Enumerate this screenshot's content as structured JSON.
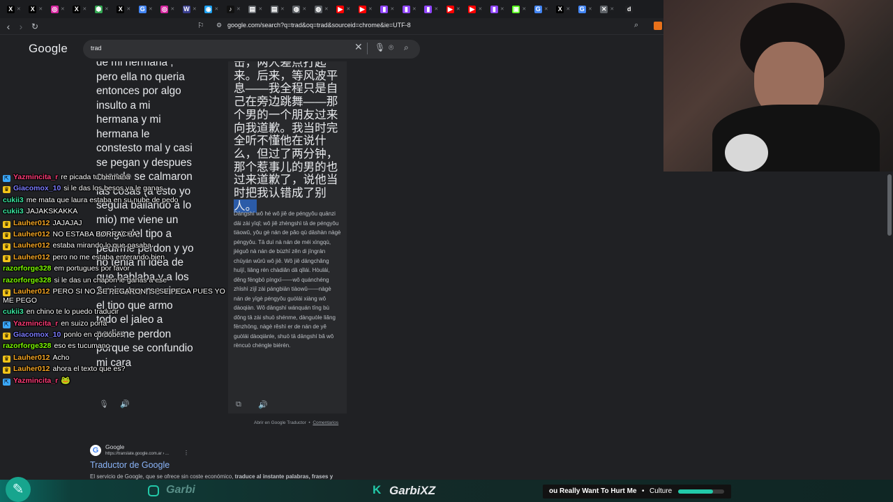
{
  "tabs": [
    {
      "icon": "x-icon",
      "glyph": "X",
      "color": "#000000"
    },
    {
      "icon": "x-icon",
      "glyph": "X",
      "color": "#000000"
    },
    {
      "icon": "instagram-icon",
      "glyph": "◎",
      "color": "#d6249f"
    },
    {
      "icon": "x-icon",
      "glyph": "X",
      "color": "#000000"
    },
    {
      "icon": "chrome-extension-icon",
      "glyph": "⬢",
      "color": "#34a853"
    },
    {
      "icon": "x-icon",
      "glyph": "X",
      "color": "#000000"
    },
    {
      "icon": "google-icon",
      "glyph": "G",
      "color": "#4285f4"
    },
    {
      "icon": "instagram-icon",
      "glyph": "◎",
      "color": "#d6249f"
    },
    {
      "icon": "app-icon",
      "glyph": "W",
      "color": "#3a3f8f"
    },
    {
      "icon": "web-icon",
      "glyph": "◉",
      "color": "#1da1f2"
    },
    {
      "icon": "tiktok-icon",
      "glyph": "♪",
      "color": "#111111"
    },
    {
      "icon": "document-icon",
      "glyph": "▤",
      "color": "#5f6368"
    },
    {
      "icon": "document-icon",
      "glyph": "▤",
      "color": "#5f6368"
    },
    {
      "icon": "globe-icon",
      "glyph": "◍",
      "color": "#5f6368"
    },
    {
      "icon": "globe-icon",
      "glyph": "◍",
      "color": "#5f6368"
    },
    {
      "icon": "youtube-icon",
      "glyph": "▶",
      "color": "#ff0000"
    },
    {
      "icon": "youtube-icon",
      "glyph": "▶",
      "color": "#ff0000"
    },
    {
      "icon": "twitch-icon",
      "glyph": "▮",
      "color": "#9146ff"
    },
    {
      "icon": "twitch-icon",
      "glyph": "▮",
      "color": "#9146ff"
    },
    {
      "icon": "twitch-icon",
      "glyph": "▮",
      "color": "#9146ff"
    },
    {
      "icon": "youtube-icon",
      "glyph": "▶",
      "color": "#ff0000"
    },
    {
      "icon": "youtube-icon",
      "glyph": "▶",
      "color": "#ff0000"
    },
    {
      "icon": "twitch-icon",
      "glyph": "▮",
      "color": "#9146ff"
    },
    {
      "icon": "kick-icon",
      "glyph": "▣",
      "color": "#53fc18"
    },
    {
      "icon": "google-icon",
      "glyph": "G",
      "color": "#4285f4"
    },
    {
      "icon": "x-icon",
      "glyph": "X",
      "color": "#000000"
    },
    {
      "icon": "google-icon",
      "glyph": "G",
      "color": "#4285f4"
    },
    {
      "icon": "mute-icon",
      "glyph": "✕",
      "color": "#5f6368"
    },
    {
      "icon": "d-icon",
      "glyph": "d",
      "color": "#202124"
    }
  ],
  "tab_extra": {
    "last_label": "S"
  },
  "address": {
    "url": "google.com/search?q=trad&oq=trad&sourceid=chrome&ie=UTF-8"
  },
  "google": {
    "logo": "Google",
    "query": "trad"
  },
  "translate": {
    "source_lines": [
      "de mi hermana ,",
      "pero ella no queria",
      "entonces por algo",
      "insulto a mi",
      "hermana y mi",
      "hermana le",
      "constesto mal y casi",
      "se pegan y despues",
      "cuando se calmaron",
      "las cosas (a esto yo",
      "seguia bailando a lo",
      "mio) me viene un",
      "amigo del tipo a",
      "pedirme perdon y yo",
      "no tenia ni idea de",
      "que hablaba y a los",
      "2 minutos me vino",
      "el tipo que armo",
      "todo el jaleo a",
      "pedirme perdon",
      "porque se confundio",
      "mi cara"
    ],
    "target_zh": "击，两人差点打起来。后来，等风波平息——我全程只是自己在旁边跳舞——那个男的一个朋友过来向我道歉。我当时完全听不懂他在说什么，但过了两分钟，那个惹事儿的男的也过来道歉了，说他当时把我认错成了别",
    "target_zh_highlight": "人。",
    "pinyin": "Dāngshí wǒ hé wǒ jiě de péngyǒu quānzi dāi zài yīqǐ; wǒ jiě zhèngshì tā de péngyǒu tiàowǔ, yǒu gè nán de pǎo qù dāshàn nàgè péngyǒu. Tā duì nà nán de méi xìngqù, jiéguǒ nà nán de bùzhī zěn di jīngrán chūyán wǔrǔ wǒ jiě. Wǒ jiě dāngchǎng huíjī, liǎng rén chàdiǎn dǎ qǐlái. Hòulái, děng fēngbō píngxī——wǒ quánchéng zhǐshì zìjǐ zài pángbiān tiàowǔ——nàgè nán de yīgè péngyǒu guòlái xiàng wǒ dàoqiàn. Wǒ dāngshí wánquán tīng bù dǒng tā zài shuō shénme, dànguòle liǎng fēnzhōng, nàgè rěshì er de nán de yě guòlái dàoqiànle, shuō tā dāngshí bǎ wǒ rèncuò chéngle biérén.",
    "open_link": "Abrir en Google Traductor",
    "separator": "•",
    "feedback_link": "Comentarios"
  },
  "chat": [
    {
      "user": "Yazmincita_r",
      "color": "#ff3c78",
      "badge": "#3ba9ff",
      "badge_glyph": "⇱",
      "text": "re picada tu hermana"
    },
    {
      "user": "Giacomox_10",
      "color": "#7b7bff",
      "badge": "#f5c518",
      "badge_glyph": "♛",
      "text": "si le das los besos ya le ganas"
    },
    {
      "user": "cukii3",
      "color": "#39e6a0",
      "badge": "",
      "badge_glyph": "",
      "text": "me mata que laura estaba en su nube de pedo"
    },
    {
      "user": "cukii3",
      "color": "#39e6a0",
      "badge": "",
      "badge_glyph": "",
      "text": "JAJAKSKAKKA"
    },
    {
      "user": "Lauher012",
      "color": "#f5a623",
      "badge": "#f5c518",
      "badge_glyph": "♛",
      "text": "JAJAJAJ"
    },
    {
      "user": "Lauher012",
      "color": "#f5a623",
      "badge": "#f5c518",
      "badge_glyph": "♛",
      "text": "NO ESTABA BORRACHA"
    },
    {
      "user": "Lauher012",
      "color": "#f5a623",
      "badge": "#f5c518",
      "badge_glyph": "♛",
      "text": "estaba mirando lo que pasaba"
    },
    {
      "user": "Lauher012",
      "color": "#f5a623",
      "badge": "#f5c518",
      "badge_glyph": "♛",
      "text": "pero no me estaba enterando bien"
    },
    {
      "user": "razorforge328",
      "color": "#7cfc00",
      "badge": "",
      "badge_glyph": "",
      "text": "em portugues por favor"
    },
    {
      "user": "razorforge328",
      "color": "#7cfc00",
      "badge": "",
      "badge_glyph": "",
      "text": "si le das un chapón le ganas a ese"
    },
    {
      "user": "Lauher012",
      "color": "#f5a623",
      "badge": "#f5c518",
      "badge_glyph": "♛",
      "text": "PERO SI NO SE PEGARON, SI SE PEGA PUES YO ME PEGO"
    },
    {
      "user": "cukii3",
      "color": "#39e6a0",
      "badge": "",
      "badge_glyph": "",
      "text": "en chino te lo puedo traducir"
    },
    {
      "user": "Yazmincita_r",
      "color": "#ff3c78",
      "badge": "#3ba9ff",
      "badge_glyph": "⇱",
      "text": "en suizo porfa"
    },
    {
      "user": "Giacomox_10",
      "color": "#7b7bff",
      "badge": "#f5c518",
      "badge_glyph": "♛",
      "text": "ponlo en cordobés"
    },
    {
      "user": "razorforge328",
      "color": "#7cfc00",
      "badge": "",
      "badge_glyph": "",
      "text": "eso es tucumano"
    },
    {
      "user": "Lauher012",
      "color": "#f5a623",
      "badge": "#f5c518",
      "badge_glyph": "♛",
      "text": "Acho"
    },
    {
      "user": "Lauher012",
      "color": "#f5a623",
      "badge": "#f5c518",
      "badge_glyph": "♛",
      "text": "ahora el texto que es?"
    },
    {
      "user": "Yazmincita_r",
      "color": "#ff3c78",
      "badge": "#3ba9ff",
      "badge_glyph": "⇱",
      "text": ""
    }
  ],
  "result": {
    "site_name": "Google",
    "url": "https://translate.google.com.ar › ...",
    "title": "Traductor de Google",
    "snippet_plain": "El servicio de Google, que se ofrece sin coste económico, ",
    "snippet_bold": "traduce al instante palabras, frases y"
  },
  "overlay": {
    "instagram_handle": "Garbi",
    "kick_handle": "GarbiXZ",
    "now_playing": "ou Really Want To Hurt Me",
    "now_playing_sep": "•",
    "now_playing_artist": "Culture",
    "progress": 0.75,
    "accent": "#22c9a8"
  }
}
